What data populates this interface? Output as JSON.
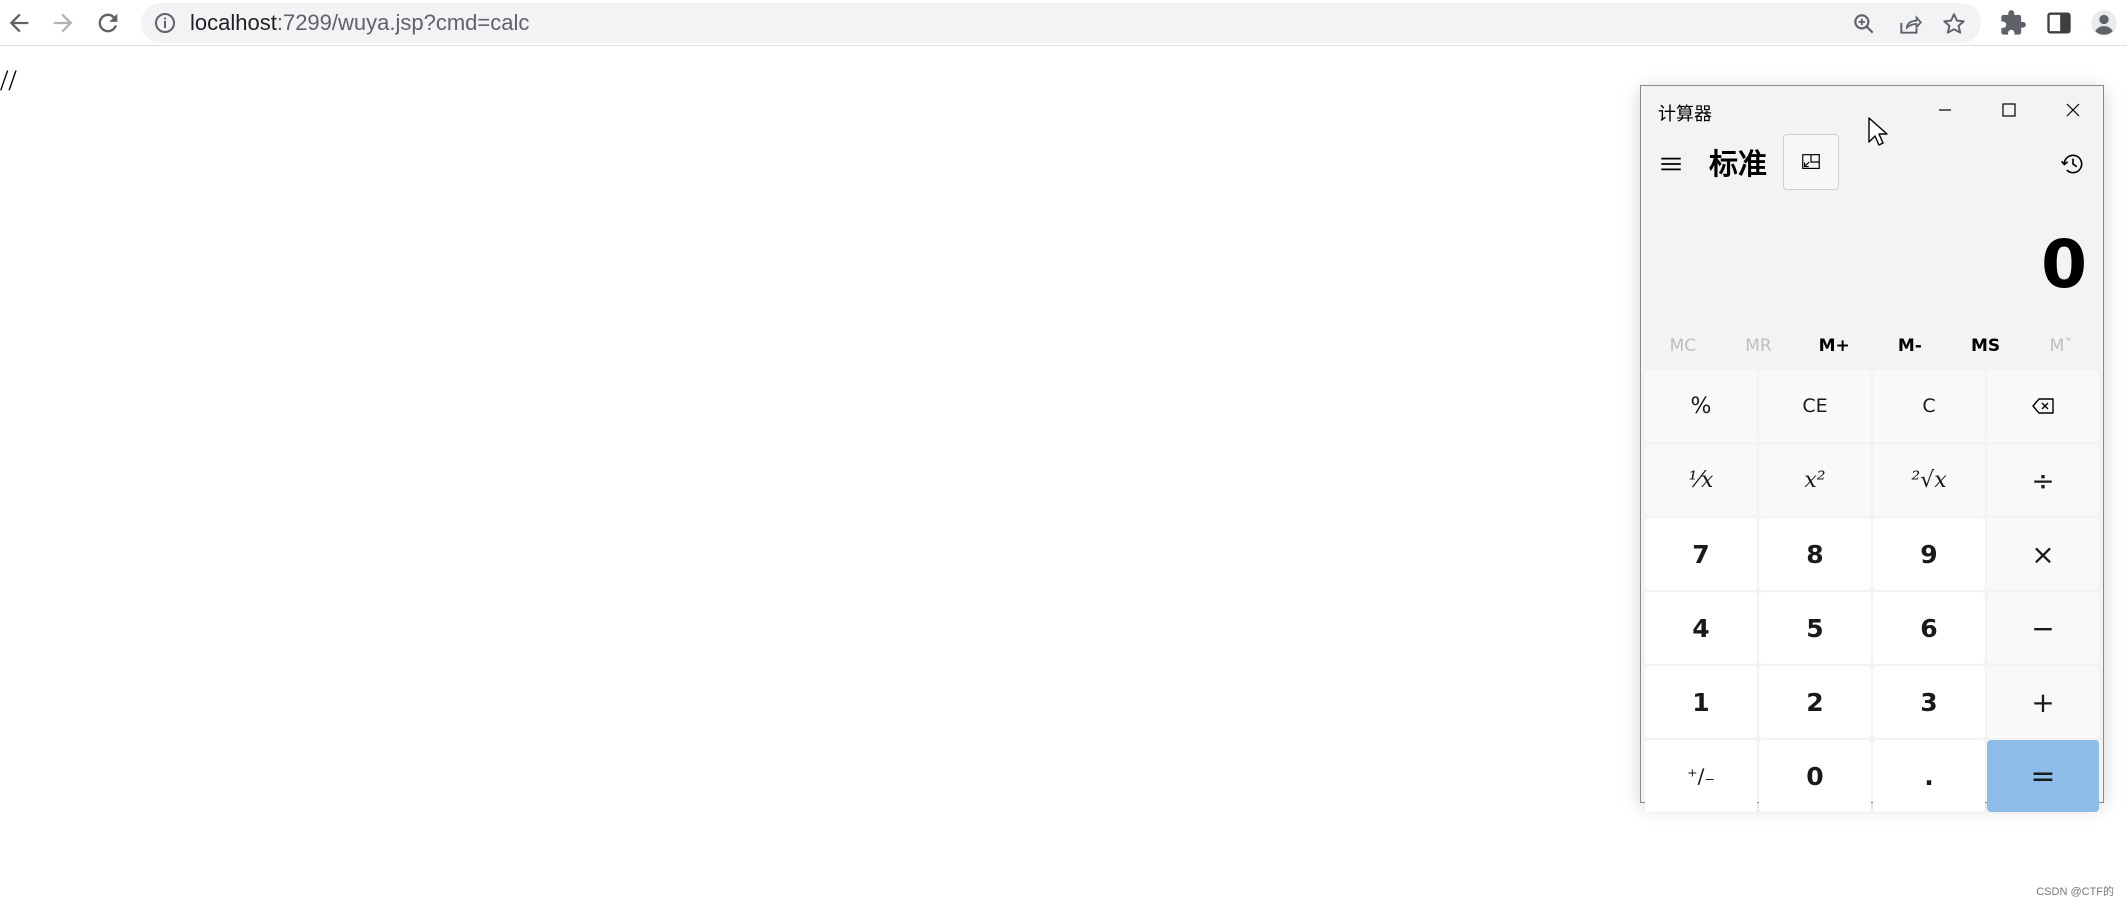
{
  "browser": {
    "url_host": "localhost",
    "url_rest": ":7299/wuya.jsp?cmd=calc",
    "icons": {
      "back": "arrow-left-icon",
      "forward": "arrow-right-icon",
      "reload": "reload-icon",
      "site_info": "info-icon",
      "zoom": "zoom-icon",
      "share": "share-icon",
      "bookmark": "star-icon",
      "extensions": "puzzle-icon",
      "side_panel": "side-panel-icon",
      "profile": "profile-icon"
    }
  },
  "page": {
    "text": "//",
    "watermark": "CSDN @CTF的"
  },
  "calculator": {
    "title": "计算器",
    "mode": "标准",
    "display": "0",
    "memory": [
      {
        "label": "MC",
        "enabled": false
      },
      {
        "label": "MR",
        "enabled": false
      },
      {
        "label": "M+",
        "enabled": true
      },
      {
        "label": "M-",
        "enabled": true
      },
      {
        "label": "MS",
        "enabled": true
      },
      {
        "label": "Mˇ",
        "enabled": false
      }
    ],
    "keys": {
      "percent": "%",
      "clear_entry": "CE",
      "clear": "C",
      "reciprocal": "⅟x",
      "square": "x²",
      "sqrt": "²√x",
      "divide": "÷",
      "seven": "7",
      "eight": "8",
      "nine": "9",
      "multiply": "×",
      "four": "4",
      "five": "5",
      "six": "6",
      "minus": "−",
      "one": "1",
      "two": "2",
      "three": "3",
      "plus": "+",
      "negate": "⁺∕₋",
      "zero": "0",
      "decimal": ".",
      "equals": "="
    },
    "colors": {
      "equals_bg": "#8dbce8",
      "window_bg": "#f3f3f3"
    }
  }
}
